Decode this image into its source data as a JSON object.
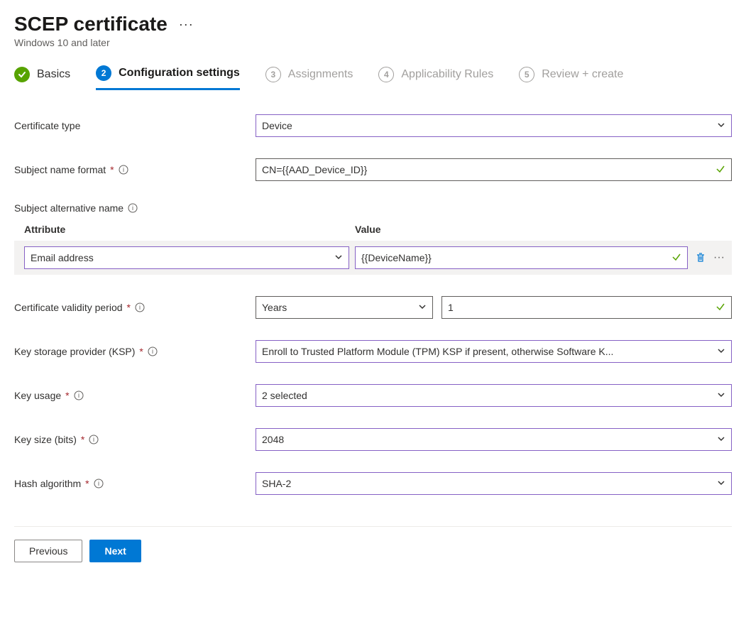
{
  "header": {
    "title": "SCEP certificate",
    "subtitle": "Windows 10 and later"
  },
  "steps": {
    "basics": "Basics",
    "config": "Configuration settings",
    "assignments_num": "3",
    "assignments": "Assignments",
    "applicability_num": "4",
    "applicability": "Applicability Rules",
    "review_num": "5",
    "review": "Review + create",
    "config_num": "2"
  },
  "labels": {
    "cert_type": "Certificate type",
    "subject_name_format": "Subject name format",
    "subject_alt_name": "Subject alternative name",
    "san_attr_header": "Attribute",
    "san_val_header": "Value",
    "validity": "Certificate validity period",
    "ksp": "Key storage provider (KSP)",
    "key_usage": "Key usage",
    "key_size": "Key size (bits)",
    "hash_algo": "Hash algorithm"
  },
  "values": {
    "cert_type": "Device",
    "subject_name_format": "CN={{AAD_Device_ID}}",
    "san_attribute": "Email address",
    "san_value": "{{DeviceName}}",
    "validity_unit": "Years",
    "validity_amount": "1",
    "ksp": "Enroll to Trusted Platform Module (TPM) KSP if present, otherwise Software K...",
    "key_usage": "2 selected",
    "key_size": "2048",
    "hash_algo": "SHA-2"
  },
  "footer": {
    "previous": "Previous",
    "next": "Next"
  }
}
